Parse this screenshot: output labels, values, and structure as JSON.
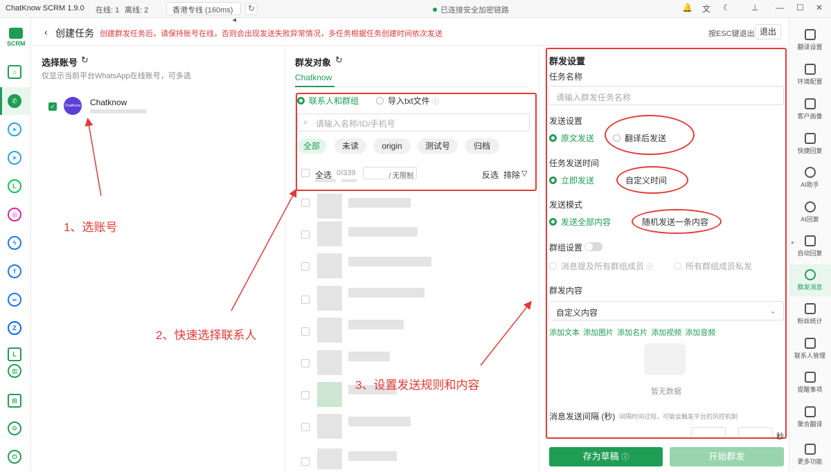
{
  "titlebar": {
    "app_title": "ChatKnow SCRM 1.9.0",
    "online": "在线: 1",
    "offline": "离线: 2",
    "line": "香港专线 (160ms)",
    "connection": "已连接安全加密链路"
  },
  "header": {
    "title": "创建任务",
    "notice": "创建群发任务后，请保持账号在线，否则会出现发送失败异常情况，多任务根据任务创建时间依次发送",
    "esc_hint": "按ESC键退出",
    "exit_label": "退出"
  },
  "account_panel": {
    "title": "选择账号",
    "subtitle": "仅显示当前平台WhatsApp在线账号，可多选",
    "account_name": "Chatknow",
    "avatar_text": "ChatKnow"
  },
  "target_panel": {
    "title": "群发对象",
    "tab": "Chatknow",
    "source_options": [
      "联系人和群组",
      "导入txt文件"
    ],
    "search_placeholder": "请输入名称/ID/手机号",
    "chips": [
      "全部",
      "未读",
      "origin",
      "测试号",
      "归档"
    ],
    "select_all": "全选",
    "count": "0/339",
    "limit": "/ 无限制",
    "invert": "反选",
    "exclude": "排除"
  },
  "settings_panel": {
    "title": "群发设置",
    "task_name_label": "任务名称",
    "task_name_placeholder": "请输入群发任务名称",
    "send_settings_label": "发送设置",
    "send_options": [
      "原文发送",
      "翻译后发送"
    ],
    "send_time_label": "任务发送时间",
    "time_options": [
      "立即发送",
      "自定义时间"
    ],
    "mode_label": "发送模式",
    "mode_options": [
      "发送全部内容",
      "随机发送一条内容"
    ],
    "group_settings_label": "群组设置",
    "group_options": [
      "消息提及所有群组成员",
      "所有群组成员私发"
    ],
    "content_label": "群发内容",
    "content_select": "自定义内容",
    "content_links": [
      "添加文本",
      "添加图片",
      "添加名片",
      "添加视频",
      "添加音频"
    ],
    "empty_text": "暂无数据",
    "interval_label": "消息发送间隔 (秒)",
    "interval_hint": "间隔时间过短，可能会触发平台的风控机制",
    "interval_unit": "秒",
    "save_draft": "存为草稿",
    "start": "开始群发"
  },
  "right_nav": [
    "翻译设置",
    "环境配置",
    "客户画像",
    "快捷回复",
    "AI助手",
    "AI回复",
    "自动回复",
    "群发消息",
    "粉丝统计",
    "联系人管理",
    "提醒事项",
    "聚合翻译",
    "更多功能"
  ],
  "annotations": {
    "step1": "1、选账号",
    "step2": "2、快速选择联系人",
    "step3": "3、设置发送规则和内容"
  },
  "left_nav_logo": "SCRM",
  "colors": {
    "accent": "#1f9d55",
    "annotation": "#e53935"
  }
}
